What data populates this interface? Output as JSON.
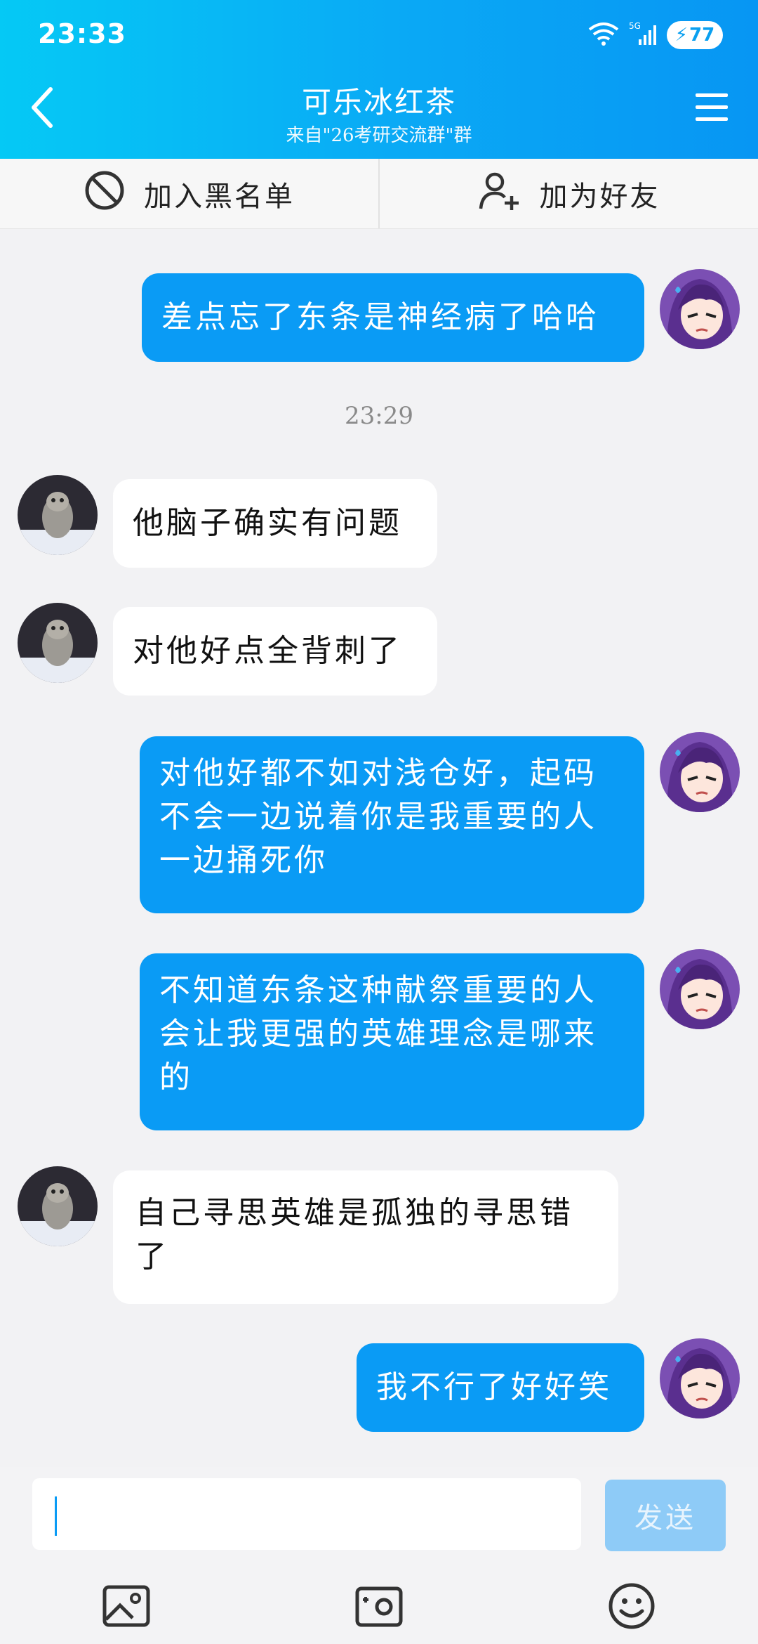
{
  "status": {
    "time": "23:33",
    "battery": "77"
  },
  "header": {
    "title": "可乐冰红茶",
    "subtitle": "来自\"26考研交流群\"群"
  },
  "actions": {
    "block_label": "加入黑名单",
    "add_friend_label": "加为好友"
  },
  "timestamp": "23:29",
  "messages": [
    {
      "side": "out",
      "text": "差点忘了东条是神经病了哈哈"
    },
    {
      "side": "in",
      "text": "他脑子确实有问题"
    },
    {
      "side": "in",
      "text": "对他好点全背刺了"
    },
    {
      "side": "out",
      "text": "对他好都不如对浅仓好，起码不会一边说着你是我重要的人一边捅死你"
    },
    {
      "side": "out",
      "text": "不知道东条这种献祭重要的人会让我更强的英雄理念是哪来的"
    },
    {
      "side": "in",
      "text": "自己寻思英雄是孤独的寻思错了"
    },
    {
      "side": "out",
      "text": "我不行了好好笑"
    }
  ],
  "input": {
    "value": "",
    "send_label": "发送"
  },
  "icons": {
    "back": "back-arrow-icon",
    "menu": "menu-icon",
    "block": "block-icon",
    "add_friend": "add-friend-icon",
    "image": "image-icon",
    "camera": "camera-icon",
    "emoji": "emoji-icon"
  },
  "colors": {
    "accent": "#0a9bf5",
    "header_start": "#05c9f5",
    "send_disabled": "#8ecbf7"
  }
}
